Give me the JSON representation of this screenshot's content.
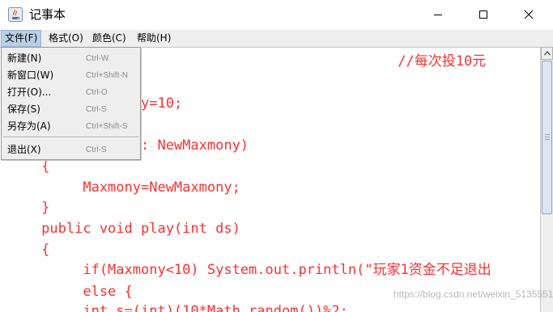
{
  "window": {
    "title": "记事本",
    "icon": "java-coffee-icon",
    "controls": [
      "minimize-icon",
      "maximize-icon",
      "close-icon"
    ]
  },
  "menubar": {
    "items": [
      {
        "label": "文件(F)"
      },
      {
        "label": "格式(O)"
      },
      {
        "label": "颜色(C)"
      },
      {
        "label": "帮助(H)"
      }
    ]
  },
  "file_menu": {
    "items": [
      {
        "label": "新建(N)",
        "accelerator": "Ctrl-W"
      },
      {
        "label": "新窗口(W)",
        "accelerator": "Ctrl+Shift-N"
      },
      {
        "label": "打开(O)...",
        "accelerator": "Ctrl-O"
      },
      {
        "label": "保存(S)",
        "accelerator": "Ctrl-S"
      },
      {
        "label": "另存为(A)",
        "accelerator": "Ctrl+Shift-S"
      },
      {
        "label": "退出(X)",
        "accelerator": "Ctrl-S"
      }
    ]
  },
  "editor": {
    "text_color": "#ff3030",
    "lines": [
      "                                                //每次投10元",
      "",
      "                 y=10;",
      "",
      "                 : NewMaxmony)",
      "     {",
      "          Maxmony=NewMaxmony;",
      "     }",
      "     public void play(int ds)",
      "     {",
      "          if(Maxmony<10) System.out.println(\"玩家1资金不足退出",
      "          else {",
      "          int s=(int)(10*Math.random())%2;"
    ]
  },
  "watermark": "https://blog.csdn.net/weixin_51355518"
}
